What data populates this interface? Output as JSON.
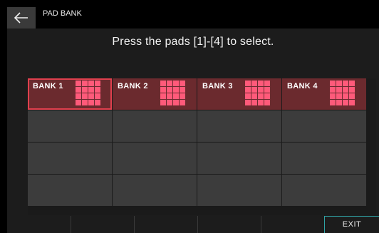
{
  "header": {
    "title": "PAD BANK",
    "back_icon": "arrow-left-icon"
  },
  "instruction": "Press the pads [1]-[4] to select.",
  "banks": [
    {
      "label": "BANK 1",
      "selected": true
    },
    {
      "label": "BANK 2",
      "selected": false
    },
    {
      "label": "BANK 3",
      "selected": false
    },
    {
      "label": "BANK 4",
      "selected": false
    }
  ],
  "footer": {
    "exit_label": "EXIT"
  },
  "colors": {
    "bank_fill": "#6b2a2e",
    "selected_border": "#e0404e",
    "pad_pink": "#ff5a7a",
    "exit_accent": "#2fa3a5"
  }
}
